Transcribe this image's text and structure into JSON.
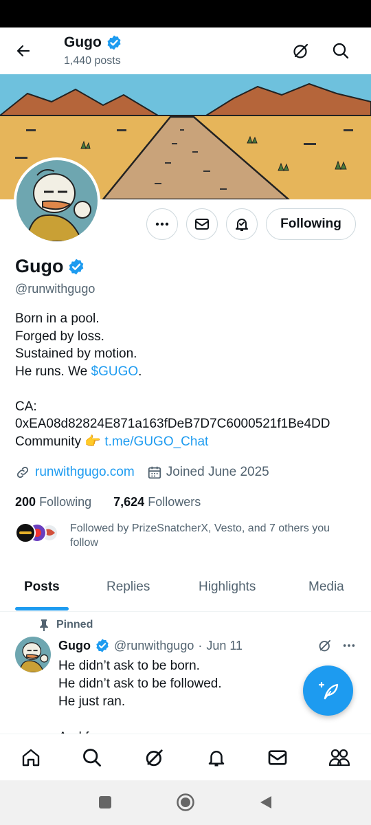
{
  "header": {
    "name": "Gugo",
    "post_count": "1,440 posts",
    "icons": [
      "back-arrow-icon",
      "grok-icon",
      "search-icon"
    ]
  },
  "profile": {
    "name": "Gugo",
    "handle": "@runwithgugo",
    "bio_lines": [
      "Born in a pool.",
      "Forged by loss.",
      "Sustained by motion.",
      "He runs. We "
    ],
    "bio_ticker": "$GUGO",
    "bio_ticker_suffix": ".",
    "ca_label": "CA:",
    "ca_address": "0xEA08d82824E871a163fDeB7D7C6000521f1Be4DD",
    "community_label": "Community",
    "community_emoji": "👉",
    "community_link": "t.me/GUGO_Chat",
    "website": "runwithgugo.com",
    "joined": "Joined June 2025",
    "following_count": "200",
    "following_label": "Following",
    "followers_count": "7,624",
    "followers_label": "Followers",
    "followed_by": "Followed by PrizeSnatcherX, Vesto, and 7 others you follow",
    "follow_button": "Following"
  },
  "tabs": [
    "Posts",
    "Replies",
    "Highlights",
    "Media"
  ],
  "active_tab": "Posts",
  "pinned_post": {
    "pinned_label": "Pinned",
    "name": "Gugo",
    "handle": "@runwithgugo",
    "separator": "·",
    "date": "Jun 11",
    "text": "He didn’t ask to be born.\nHe didn’t ask to be followed.\nHe just ran.\n\nAnd f"
  },
  "colors": {
    "accent": "#1d9bf0",
    "text": "#0f1419",
    "muted": "#536471",
    "sky": "#6ec1dd",
    "sand": "#e6b55a",
    "road": "#c9a37a",
    "mountain": "#b5653a"
  }
}
